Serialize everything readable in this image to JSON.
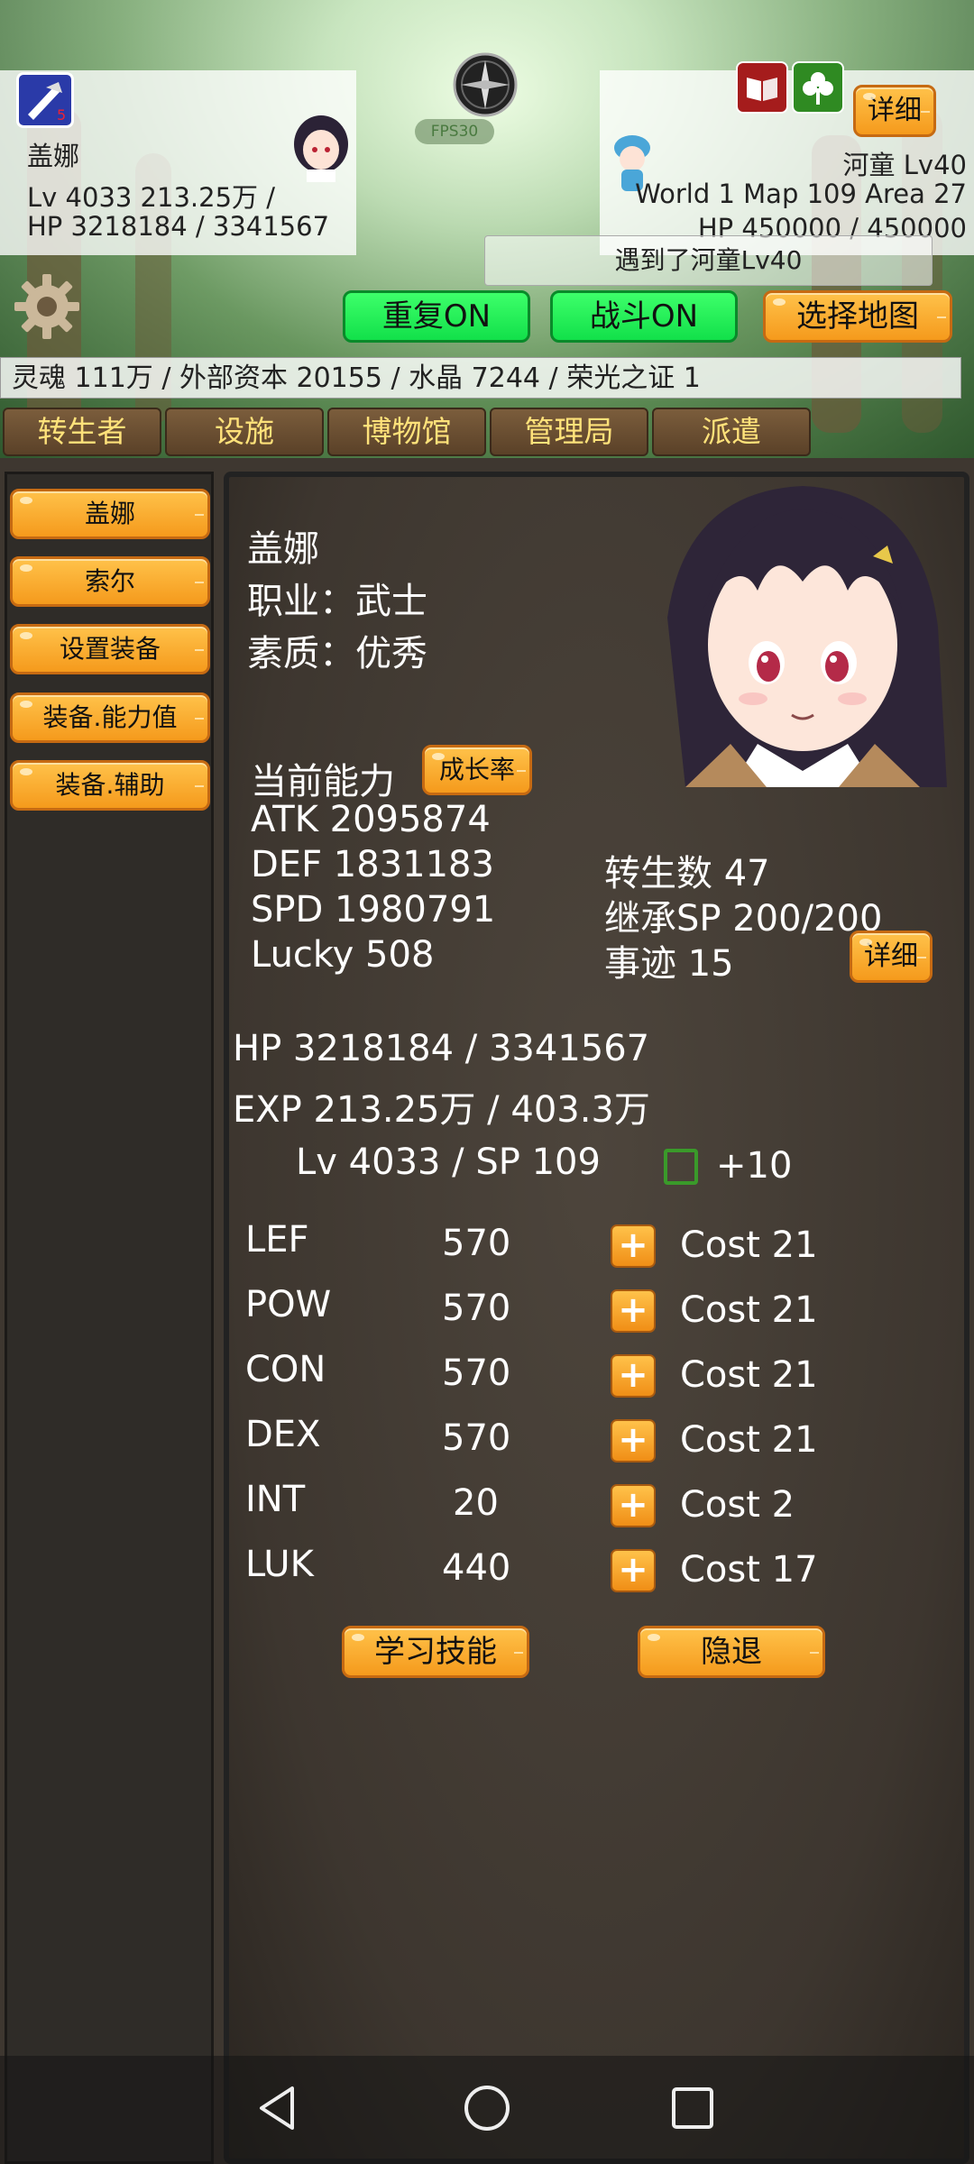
{
  "player": {
    "name": "盖娜",
    "level_line": "Lv 4033 213.25万 /",
    "hp_line": "HP 3218184 / 3341567"
  },
  "fps": "FPS30",
  "enemy": {
    "name_line": "河童 Lv40",
    "location": "World 1 Map 109 Area 27",
    "hp_line": "HP 450000 / 450000",
    "detail_label": "详细"
  },
  "encounter_text": "遇到了河童Lv40",
  "controls": {
    "repeat": "重复ON",
    "battle": "战斗ON",
    "select_map": "选择地图"
  },
  "resources": "灵魂 111万 / 外部资本 20155 / 水晶 7244 / 荣光之证 1",
  "tabs": [
    "转生者",
    "设施",
    "博物馆",
    "管理局",
    "派遣"
  ],
  "sidebar": [
    "盖娜",
    "索尔",
    "设置装备",
    "装备.能力值",
    "装备.辅助"
  ],
  "character": {
    "name": "盖娜",
    "job": "职业：武士",
    "quality": "素质：优秀",
    "current_ability": "当前能力",
    "growth_rate_btn": "成长率",
    "atk": "ATK 2095874",
    "def": "DEF 1831183",
    "spd": "SPD 1980791",
    "lucky": "Lucky 508",
    "rebirths": "转生数 47",
    "inherit_sp": "继承SP 200/200",
    "deeds": "事迹 15",
    "detail_label": "详细",
    "hp": "HP 3218184 / 3341567",
    "exp": "EXP 213.25万 / 403.3万",
    "lv_sp": "Lv 4033 / SP 109",
    "plus10": "+10"
  },
  "stats": [
    {
      "name": "LEF",
      "value": "570",
      "cost": "Cost 21"
    },
    {
      "name": "POW",
      "value": "570",
      "cost": "Cost 21"
    },
    {
      "name": "CON",
      "value": "570",
      "cost": "Cost 21"
    },
    {
      "name": "DEX",
      "value": "570",
      "cost": "Cost 21"
    },
    {
      "name": "INT",
      "value": "20",
      "cost": "Cost 2"
    },
    {
      "name": "LUK",
      "value": "440",
      "cost": "Cost 17"
    }
  ],
  "actions": {
    "learn_skill": "学习技能",
    "retire": "隐退"
  },
  "icons": [
    "sword-badge-icon",
    "compass-icon",
    "book-icon",
    "clover-icon",
    "gear-icon",
    "back-icon",
    "home-icon",
    "recents-icon"
  ],
  "colors": {
    "green_button": "#12e04a",
    "orange_button": "#f59a1c",
    "tab_text": "#ffe27a"
  }
}
